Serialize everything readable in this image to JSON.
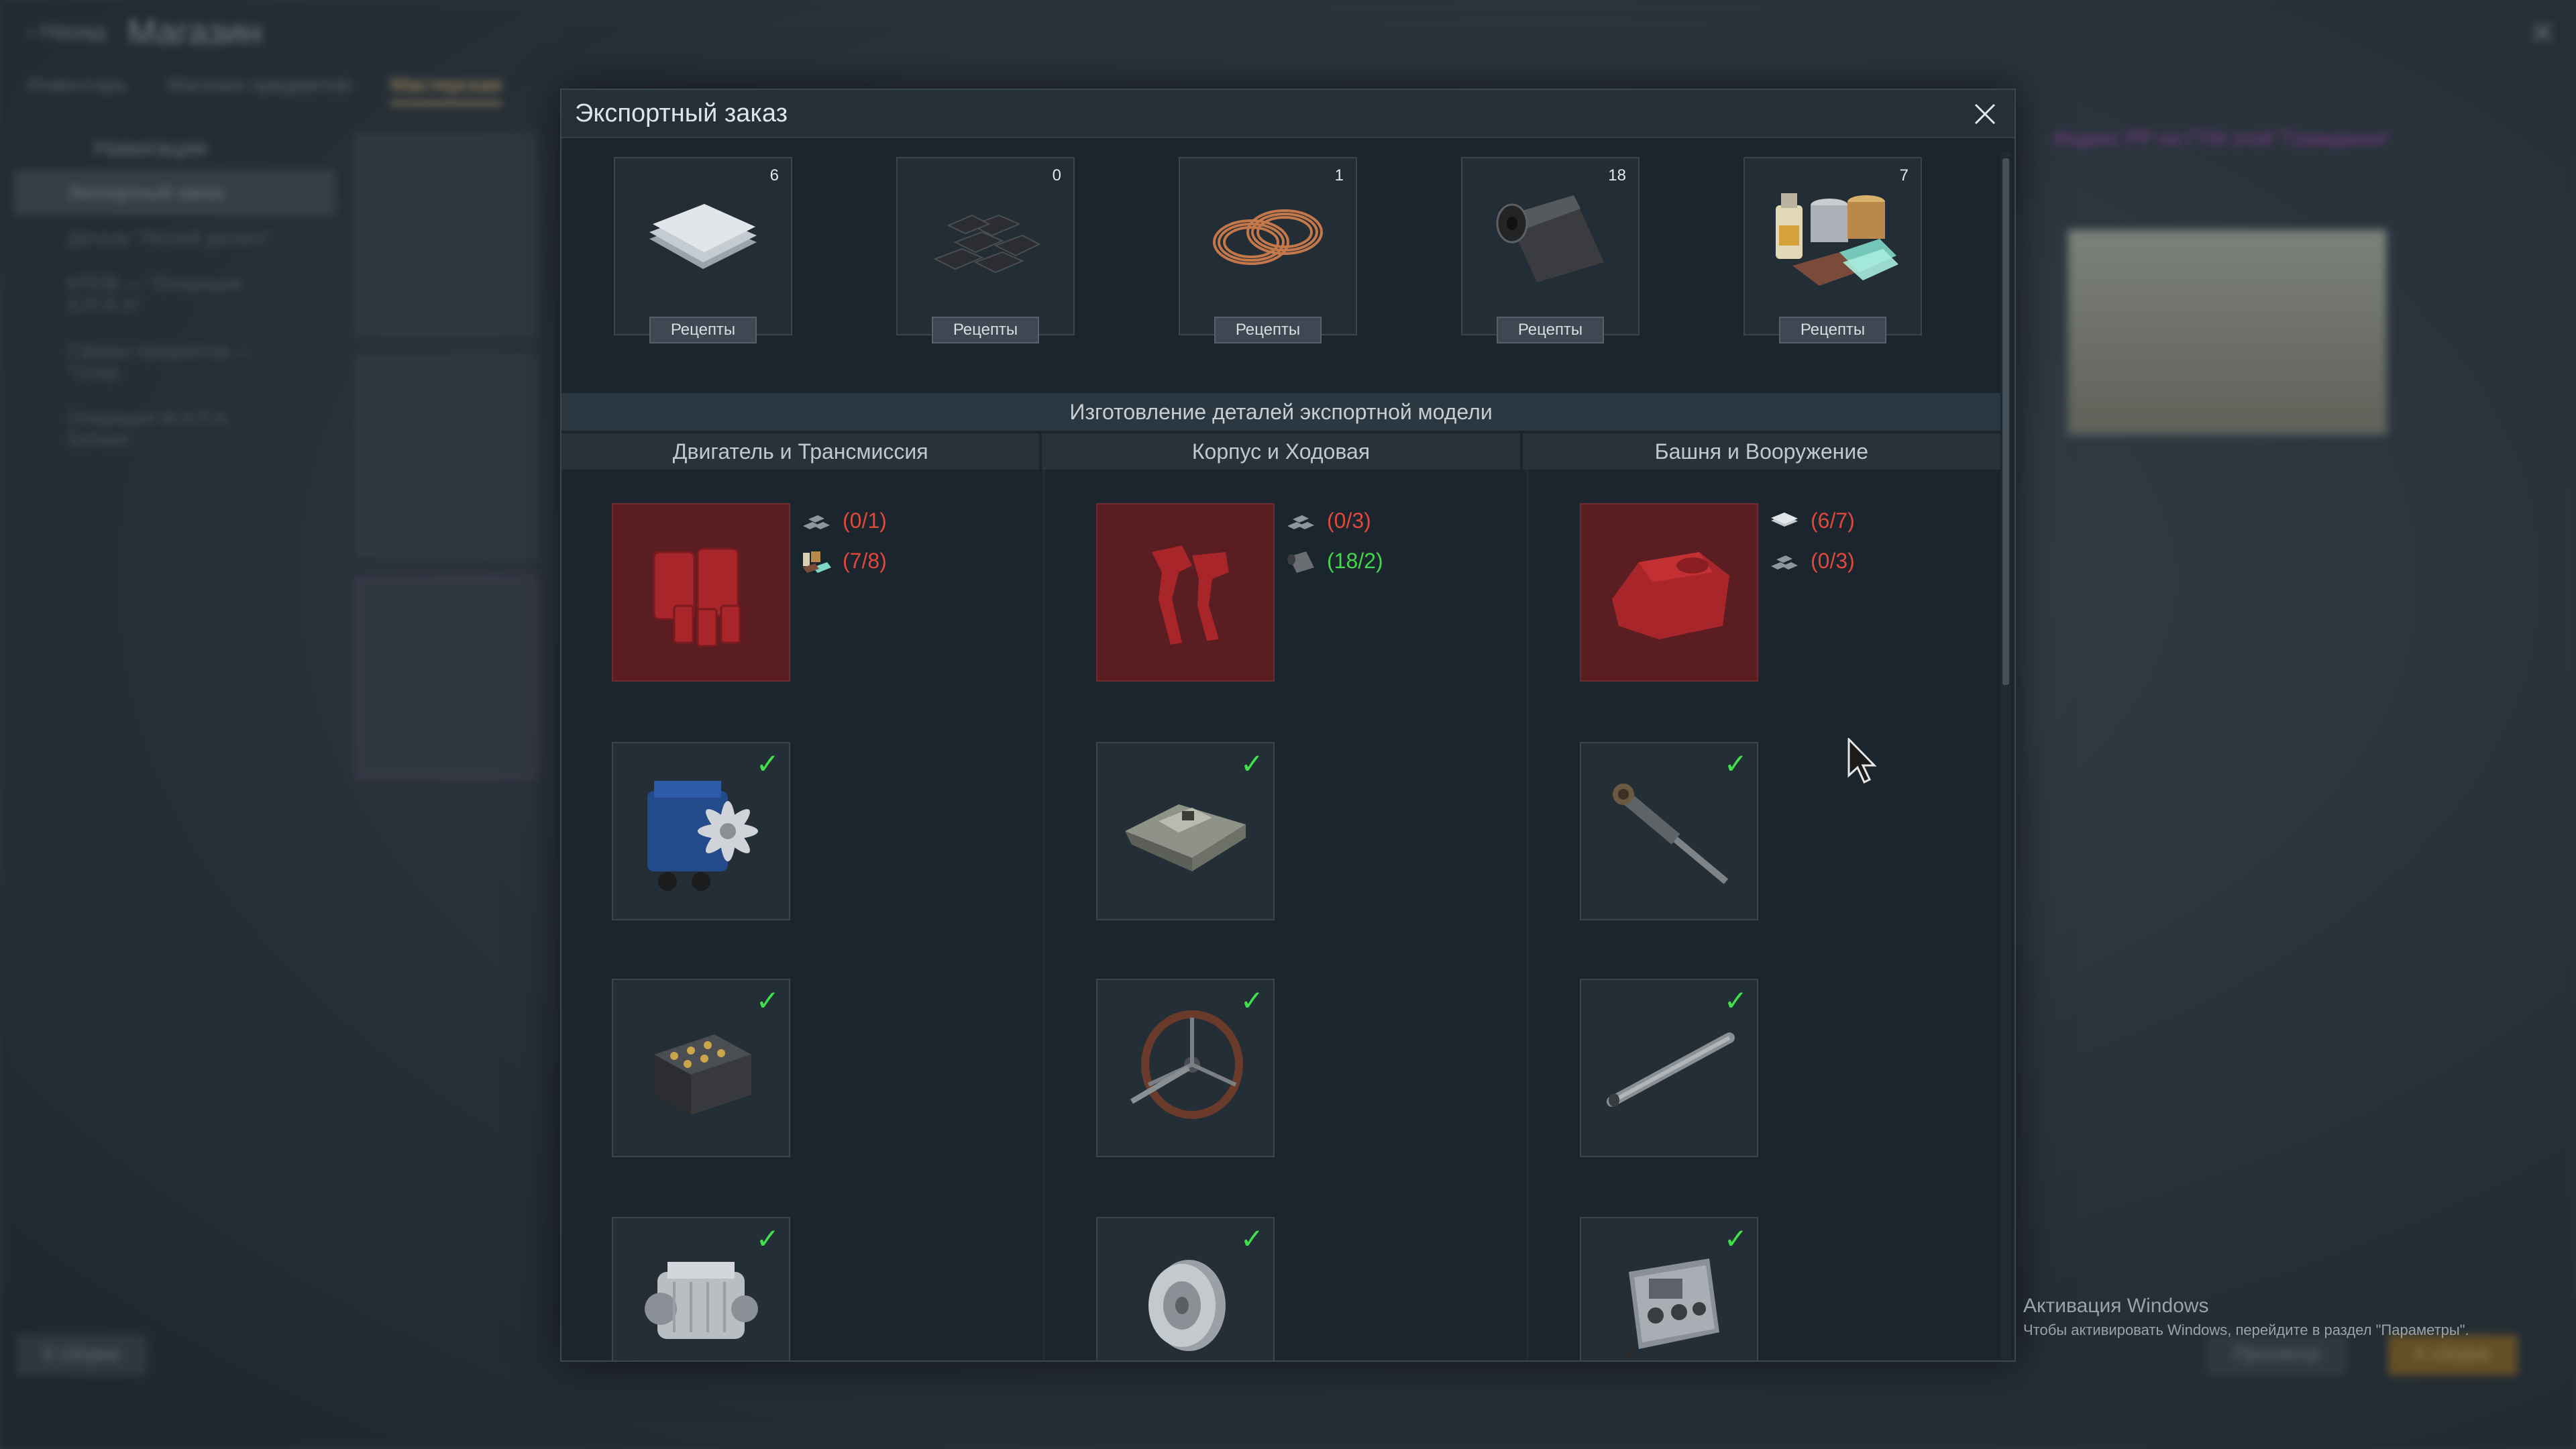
{
  "background": {
    "back_label": "Назад",
    "title": "Магазин",
    "tabs": [
      "Инвентарь",
      "Магазин предметов",
      "Мастерская"
    ],
    "nav_title": "Навигация",
    "nav_items": [
      "Экспортный заказ",
      "Детали \"Легкий десант\"",
      "КПОВ — \"Операция S.R.R.A\"",
      "Сферы предметов — \"Опер",
      "Операция W.A.F.A. Schwer-"
    ],
    "right_info": "Индекс PP на ГТМ этой \"Гражданки\"",
    "bottom_left": "К сборке",
    "bottom_right_1": "Просмотр",
    "bottom_right_2": "К сборке"
  },
  "dialog": {
    "title": "Экспортный заказ",
    "resources": [
      {
        "name": "steel-sheets-icon",
        "count": "6",
        "button": "Рецепты"
      },
      {
        "name": "iron-ingots-icon",
        "count": "0",
        "button": "Рецепты"
      },
      {
        "name": "copper-wire-icon",
        "count": "1",
        "button": "Рецепты"
      },
      {
        "name": "rubber-roll-icon",
        "count": "18",
        "button": "Рецепты"
      },
      {
        "name": "paints-and-materials-icon",
        "count": "7",
        "button": "Рецепты"
      }
    ],
    "section_title": "Изготовление деталей экспортной модели",
    "columns": [
      {
        "header": "Двигатель и Трансмиссия",
        "requirements": [
          {
            "icon": "ingots-icon",
            "text": "(0/1)",
            "status": "red"
          },
          {
            "icon": "materials-icon",
            "text": "(7/8)",
            "status": "red"
          }
        ],
        "parts": [
          "fuel-tanks-icon",
          "engine-icon",
          "battery-icon",
          "gearbox-icon"
        ]
      },
      {
        "header": "Корпус и Ходовая",
        "requirements": [
          {
            "icon": "ingots-icon",
            "text": "(0/3)",
            "status": "red"
          },
          {
            "icon": "rubber-icon",
            "text": "(18/2)",
            "status": "green"
          }
        ],
        "parts": [
          "pedals-icon",
          "hull-icon",
          "steering-wheel-icon",
          "road-wheel-icon"
        ]
      },
      {
        "header": "Башня и Вооружение",
        "requirements": [
          {
            "icon": "sheets-icon",
            "text": "(6/7)",
            "status": "red"
          },
          {
            "icon": "ingots-icon",
            "text": "(0/3)",
            "status": "red"
          }
        ],
        "parts": [
          "turret-icon",
          "gun-breech-icon",
          "gun-barrel-icon",
          "radio-icon"
        ]
      }
    ],
    "completed_checkmark": "✓"
  },
  "windows_activation": {
    "line1": "Активация Windows",
    "line2": "Чтобы активировать Windows, перейдите в раздел \"Параметры\"."
  },
  "colors": {
    "accent_red": "#e2483a",
    "accent_green": "#43d64d",
    "locked_bg": "#5a1d22",
    "dialog_bg": "#1b252d"
  }
}
